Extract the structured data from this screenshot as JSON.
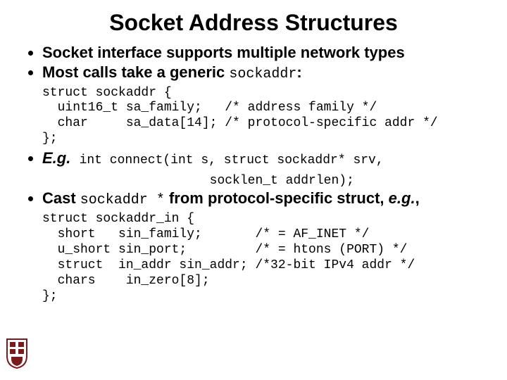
{
  "title": "Socket Address Structures",
  "bullets": {
    "b1": "Socket interface supports multiple network types",
    "b2_prefix": "Most calls take a generic ",
    "b2_code": "sockaddr",
    "b2_suffix": ":",
    "code1": "struct sockaddr {\n  uint16_t sa_family;   /* address family */\n  char     sa_data[14]; /* protocol-specific addr */\n};",
    "eg_label": "E.g.",
    "eg_code": "int connect(int s, struct sockaddr* srv,\n                      socklen_t addrlen);",
    "b4_prefix": "Cast ",
    "b4_code": "sockaddr *",
    "b4_mid": " from protocol-specific struct, ",
    "b4_eg": "e.g.",
    "b4_comma": ",",
    "code2": "struct sockaddr_in {\n  short   sin_family;       /* = AF_INET */\n  u_short sin_port;         /* = htons (PORT) */\n  struct  in_addr sin_addr; /*32-bit IPv4 addr */\n  chars    in_zero[8];\n};"
  }
}
